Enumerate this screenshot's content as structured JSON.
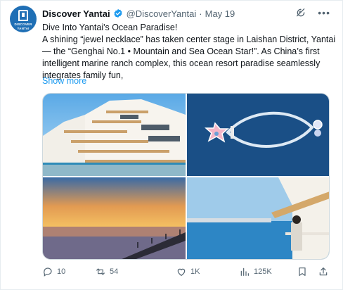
{
  "post": {
    "avatar_text_1": "DISCOVER",
    "avatar_text_2": "YANTAI",
    "display_name": "Discover Yantai",
    "handle": "@DiscoverYantai",
    "separator": "·",
    "date": "May 19",
    "title_line": "Dive Into Yantai's Ocean Paradise!",
    "body": "A shining “jewel necklace” has taken center stage in Laishan District, Yantai— the “Genghai No.1 • Mountain and Sea Ocean Star!”. As China’s first intelligent marine ranch complex, this ocean resort paradise seamlessly integrates family fun,",
    "show_more": "Show more"
  },
  "actions": {
    "replies": "10",
    "reposts": "54",
    "likes": "1K",
    "views": "125K"
  },
  "icons": [
    "verified-badge-icon",
    "grok-icon",
    "more-icon",
    "reply-icon",
    "repost-icon",
    "like-icon",
    "views-icon",
    "bookmark-icon",
    "share-icon"
  ],
  "colors": {
    "accent": "#1d9bf0",
    "muted": "#536471",
    "repost_green": "#00ba7c",
    "avatar_blue": "#1f6fb5"
  }
}
